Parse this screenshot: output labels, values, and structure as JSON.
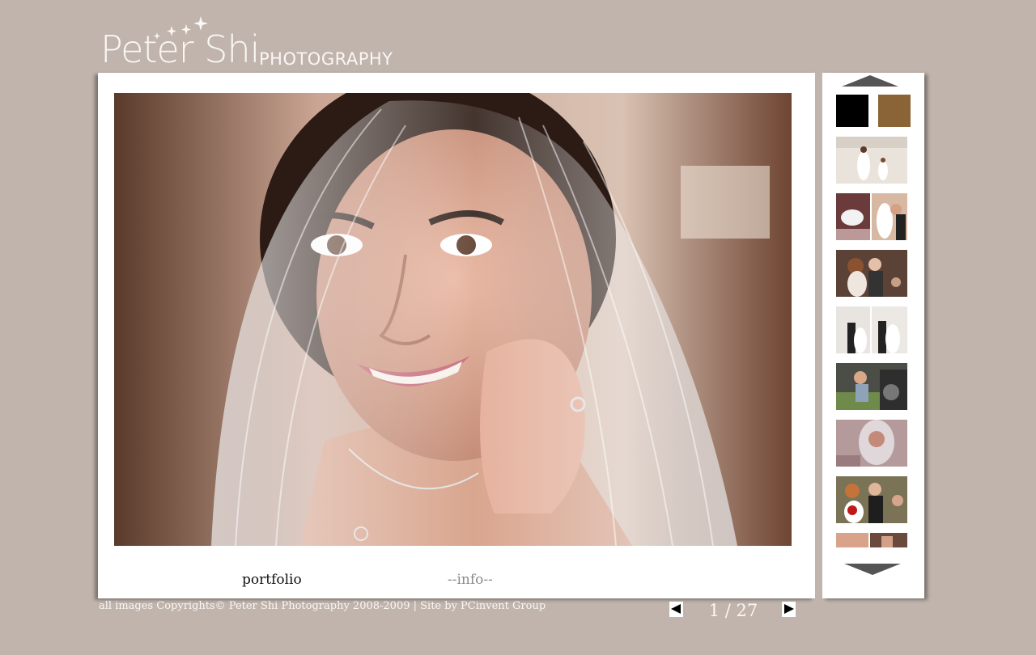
{
  "brand": {
    "name": "Peter Shi",
    "subtitle": "PHOTOGRAPHY"
  },
  "nav": {
    "portfolio_label": "portfolio",
    "info_label": "--info--"
  },
  "main_photo": {
    "subject": "bride in veil smiling"
  },
  "thumbnail_panel": {
    "swatches": [
      {
        "name": "black",
        "color": "#000000"
      },
      {
        "name": "brown",
        "color": "#8a6336"
      }
    ],
    "thumbnails": [
      "bride and flower girl dancing",
      "table flowers and bride",
      "bride and father dancing",
      "couple portraits",
      "child near car",
      "bride with veil",
      "couple with bouquet",
      "faces close-up"
    ]
  },
  "footer": {
    "copyright": "all images Copyrights© Peter Shi Photography 2008-2009 | Site by PCinvent Group"
  },
  "pager": {
    "current": 1,
    "total": 27,
    "text": "1 / 27"
  },
  "colors": {
    "background": "#c0b4ad",
    "panel": "#ffffff",
    "arrow": "#555555"
  }
}
